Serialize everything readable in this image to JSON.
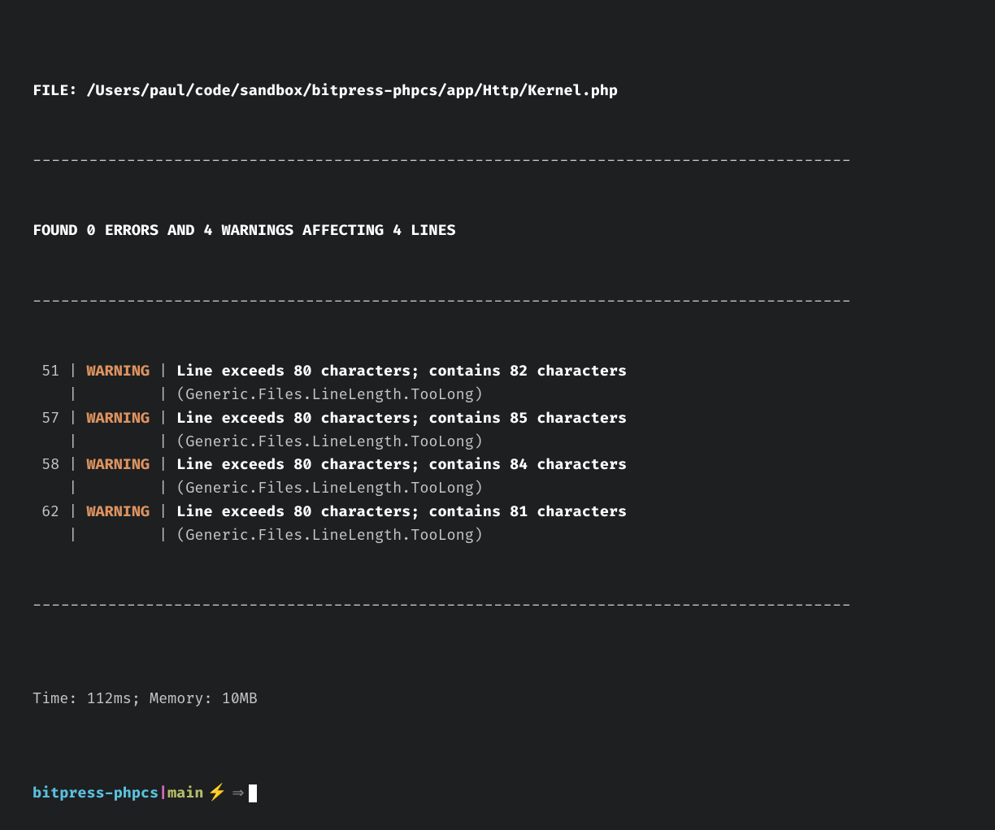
{
  "header": {
    "file_label": "FILE: ",
    "file_path": "/Users/paul/code/sandbox/bitpress-phpcs/app/Http/Kernel.php"
  },
  "divider": "---------------------------------------------------------------------------------------",
  "summary": "FOUND 0 ERRORS AND 4 WARNINGS AFFECTING 4 LINES",
  "warnings": [
    {
      "line": "51",
      "level": "WARNING",
      "message": "Line exceeds 80 characters; contains 82 characters",
      "rule": "(Generic.Files.LineLength.TooLong)"
    },
    {
      "line": "57",
      "level": "WARNING",
      "message": "Line exceeds 80 characters; contains 85 characters",
      "rule": "(Generic.Files.LineLength.TooLong)"
    },
    {
      "line": "58",
      "level": "WARNING",
      "message": "Line exceeds 80 characters; contains 84 characters",
      "rule": "(Generic.Files.LineLength.TooLong)"
    },
    {
      "line": "62",
      "level": "WARNING",
      "message": "Line exceeds 80 characters; contains 81 characters",
      "rule": "(Generic.Files.LineLength.TooLong)"
    }
  ],
  "stats": {
    "time_label": "Time: ",
    "time_value": "112ms",
    "memory_label": "; Memory: ",
    "memory_value": "10MB"
  },
  "prompt": {
    "dir": "bitpress-phpcs",
    "separator": "|",
    "branch": "main",
    "bolt": "⚡",
    "arrow": "⇒"
  }
}
